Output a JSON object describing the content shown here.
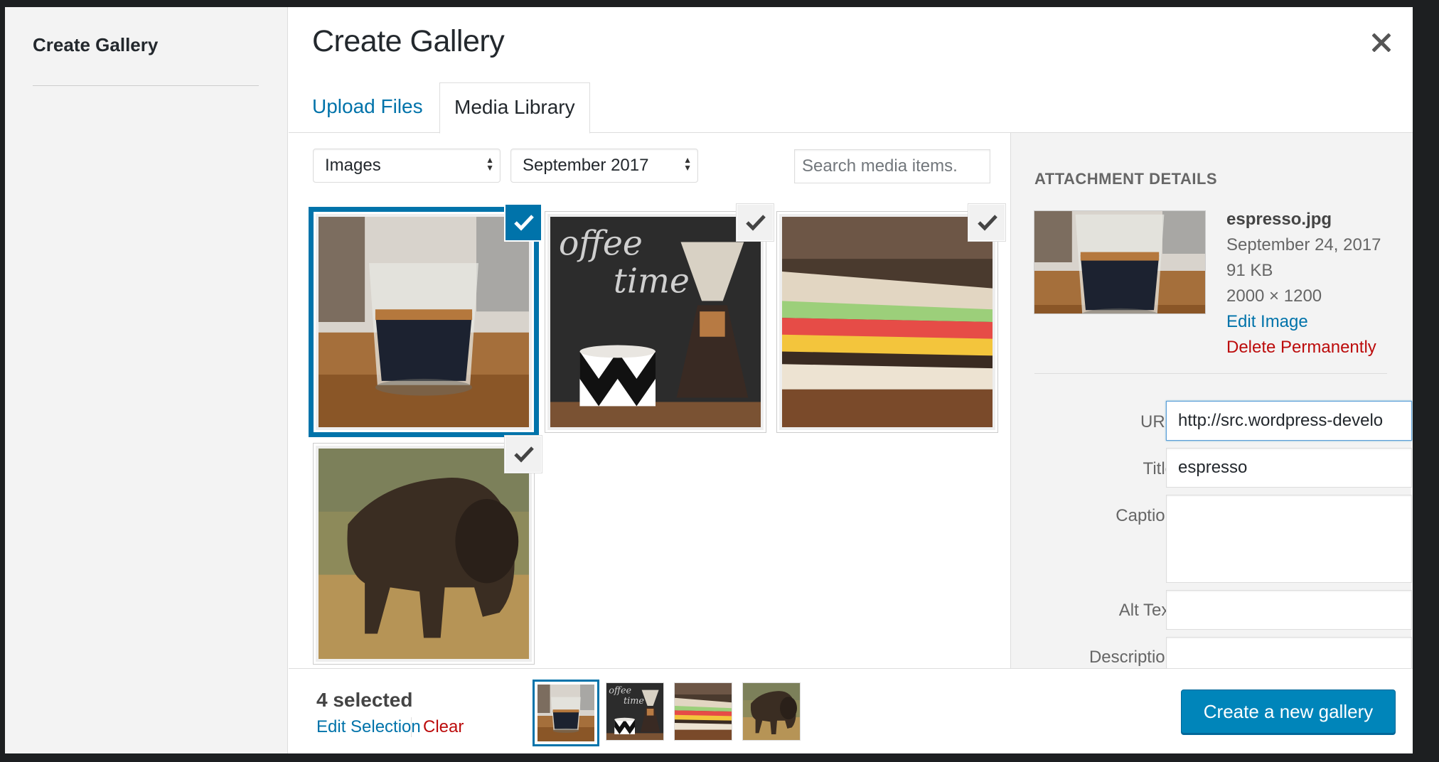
{
  "menu": {
    "title": "Create Gallery"
  },
  "frame": {
    "title": "Create Gallery",
    "close_icon": "close-icon"
  },
  "tabs": [
    {
      "label": "Upload Files",
      "active": false
    },
    {
      "label": "Media Library",
      "active": true
    }
  ],
  "filters": {
    "type": "Images",
    "date": "September 2017",
    "search_placeholder": "Search media items."
  },
  "attachments": [
    {
      "name": "espresso",
      "selected": true,
      "current": true
    },
    {
      "name": "coffee-time",
      "selected": true,
      "current": false
    },
    {
      "name": "sandwich",
      "selected": true,
      "current": false
    },
    {
      "name": "bison",
      "selected": true,
      "current": false
    }
  ],
  "details": {
    "heading": "ATTACHMENT DETAILS",
    "filename": "espresso.jpg",
    "date": "September 24, 2017",
    "size": "91 KB",
    "dimensions": "2000 × 1200",
    "edit_link": "Edit Image",
    "delete_link": "Delete Permanently",
    "fields": {
      "url_label": "URL",
      "url_value": "http://src.wordpress-develo",
      "title_label": "Title",
      "title_value": "espresso",
      "caption_label": "Caption",
      "caption_value": "",
      "alt_label": "Alt Text",
      "alt_value": "",
      "description_label": "Description",
      "description_value": ""
    }
  },
  "toolbar": {
    "selected_count": "4 selected",
    "edit_selection": "Edit Selection",
    "clear": "Clear",
    "create_button": "Create a new gallery"
  },
  "colors": {
    "accent": "#0073aa",
    "danger": "#bc0b0b",
    "primary_button": "#0085ba"
  }
}
